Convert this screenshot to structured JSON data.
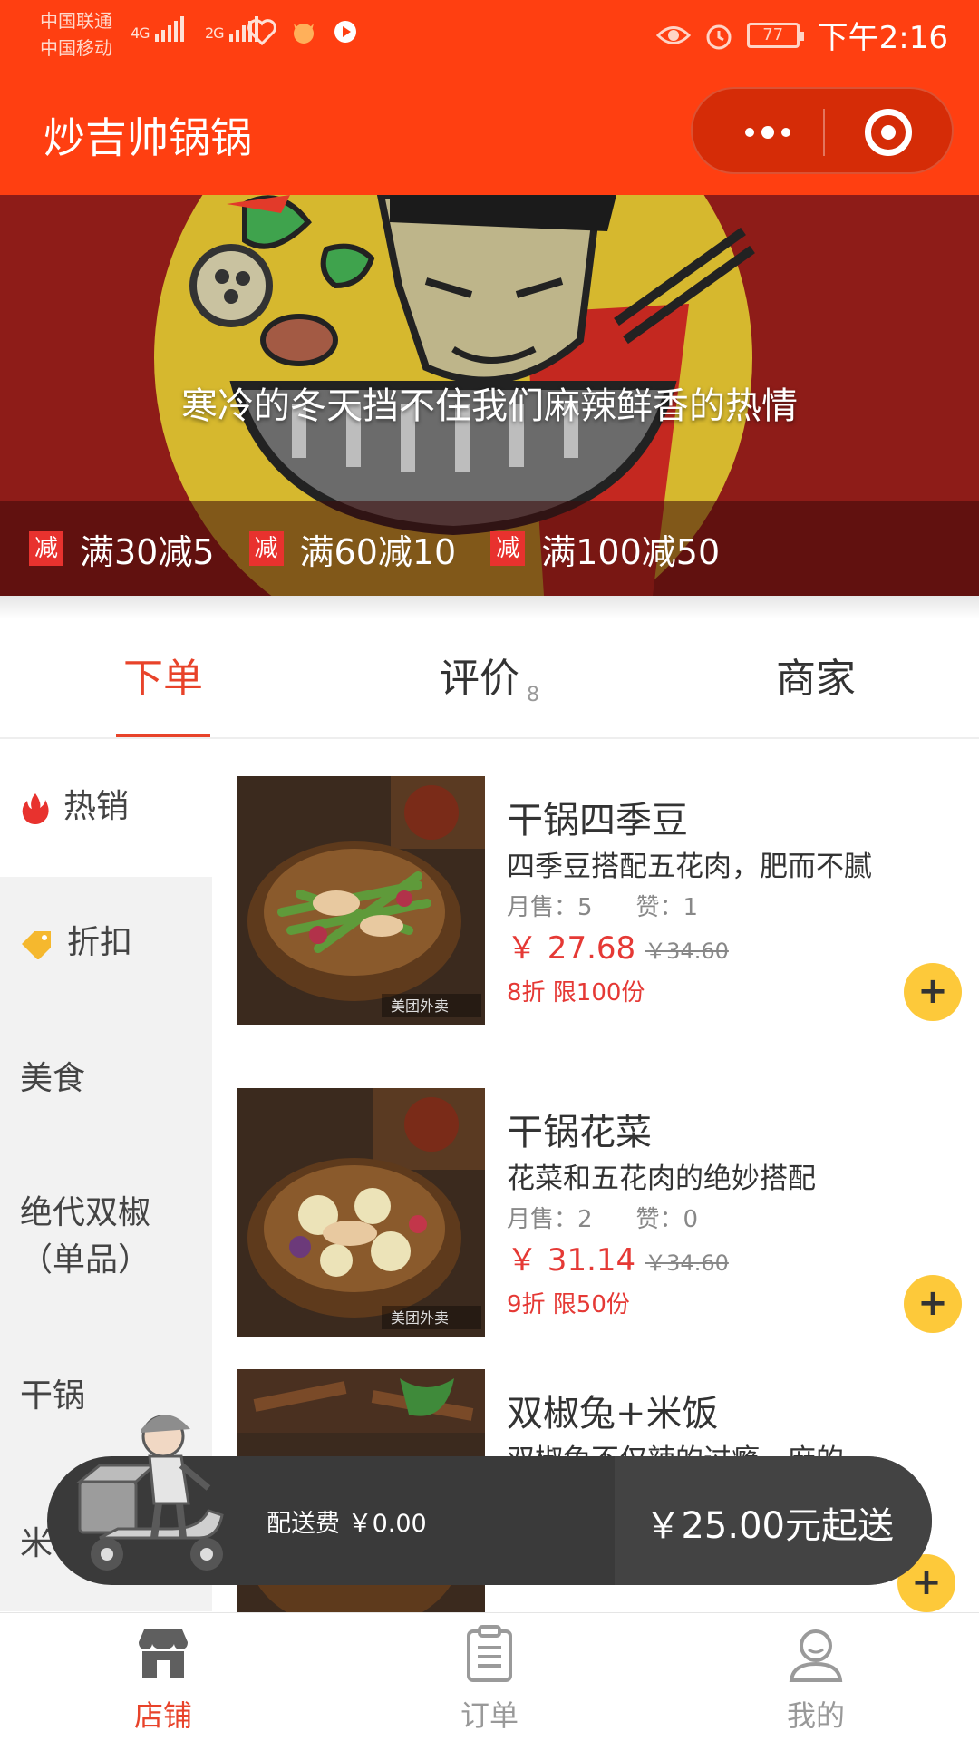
{
  "status_bar": {
    "carrier_1": "中国联通",
    "carrier_2": "中国移动",
    "net_1": "4G",
    "net_2": "2G",
    "battery": "77",
    "time": "下午2:16"
  },
  "title_bar": {
    "title": "炒吉帅锅锅"
  },
  "banner": {
    "slogan": "寒冷的冬天挡不住我们麻辣鲜香的热情",
    "promotions": [
      {
        "badge": "减",
        "text": "满30减5"
      },
      {
        "badge": "减",
        "text": "满60减10"
      },
      {
        "badge": "减",
        "text": "满100减50"
      }
    ]
  },
  "tabs": [
    {
      "label": "下单",
      "count": ""
    },
    {
      "label": "评价",
      "count": "8"
    },
    {
      "label": "商家",
      "count": ""
    }
  ],
  "categories": [
    {
      "label": "热销",
      "icon": "flame-icon"
    },
    {
      "label": "折扣",
      "icon": "tag-icon"
    },
    {
      "label": "美食",
      "icon": ""
    },
    {
      "label": "绝代双椒",
      "label_2": "（单品）",
      "icon": ""
    },
    {
      "label": "干锅",
      "icon": ""
    },
    {
      "label": "米",
      "icon": ""
    }
  ],
  "products": [
    {
      "name": "干锅四季豆",
      "desc": "四季豆搭配五花肉，肥而不腻",
      "sales": "月售：5",
      "likes": "赞：1",
      "price": "￥ 27.68",
      "old_price": "￥34.60",
      "discount": "8折 限100份",
      "watermark": "美团外卖"
    },
    {
      "name": "干锅花菜",
      "desc": "花菜和五花肉的绝妙搭配",
      "sales": "月售：2",
      "likes": "赞：0",
      "price": "￥ 31.14",
      "old_price": "￥34.60",
      "discount": "9折 限50份",
      "watermark": "美团外卖"
    },
    {
      "name": "双椒兔+米饭",
      "desc": "双椒兔不仅辣的过瘾，麻的…"
    }
  ],
  "cart": {
    "delivery_fee": "配送费 ￥0.00",
    "min_order": "￥25.00元起送"
  },
  "bottom_nav": [
    {
      "label": "店铺",
      "icon": "store-icon"
    },
    {
      "label": "订单",
      "icon": "clipboard-icon"
    },
    {
      "label": "我的",
      "icon": "user-icon"
    }
  ],
  "colors": {
    "brand": "#FF3F11",
    "accent": "#E8432A",
    "price": "#E53935",
    "add_button": "#FDC93A"
  }
}
